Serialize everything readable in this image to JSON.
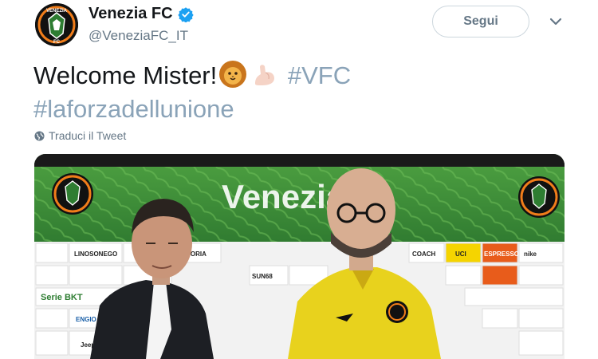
{
  "account": {
    "display_name": "Venezia FC",
    "handle": "@VeneziaFC_IT",
    "avatar_text": "VENEZIA",
    "avatar_sub": "FC"
  },
  "follow": {
    "label": "Segui"
  },
  "tweet": {
    "text_main": "Welcome Mister!",
    "hashtag_1": "#VFC",
    "hashtag_2": "#laforzadellunione",
    "emoji_1": "lion-face-icon",
    "emoji_2": "flexed-biceps-icon"
  },
  "translate": {
    "label": "Traduci il Tweet"
  },
  "media": {
    "backdrop_word": "Venezia",
    "sponsors": [
      "LINOSONEGO",
      "ASTORIA",
      "SUN68",
      "COACH",
      "UCI",
      "ESPRESSO",
      "Serie BKT",
      "ENGIO",
      "Jeep",
      "nike"
    ]
  },
  "colors": {
    "backdrop_green": "#3f8f3a",
    "backdrop_dark": "#1f5a22",
    "shirt_yellow": "#e8d21d",
    "link": "#8aa3b8",
    "muted": "#657786"
  }
}
